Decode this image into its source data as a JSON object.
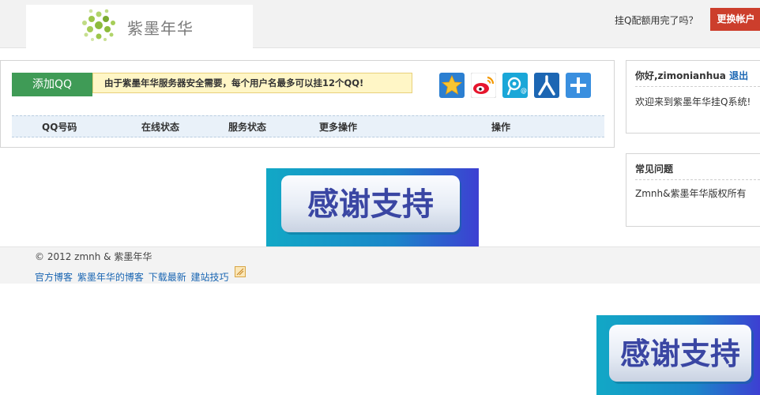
{
  "header": {
    "logo_text": "紫墨年华",
    "quota_link": "挂Q配额用完了吗？",
    "switch_account": "更换帐户"
  },
  "main": {
    "add_qq_button": "添加QQ",
    "notice": "由于紫墨年华服务器安全需要，每个用户名最多可以挂12个QQ!",
    "share_icons": [
      "qzone-icon",
      "weibo-icon",
      "tencent-weibo-icon",
      "renren-icon",
      "more-share-icon"
    ],
    "table_headers": [
      "QQ号码",
      "在线状态",
      "服务状态",
      "更多操作",
      "操作"
    ],
    "colors": {
      "add_button": "#3f9b56",
      "notice_bg": "#fff6c6",
      "table_head_bg": "#e9f1f9",
      "switch_button": "#cc3e2c"
    }
  },
  "sidebar": {
    "greeting": "你好,zimonianhua",
    "logout": "退出",
    "welcome": "欢迎来到紫墨年华挂Q系统!",
    "faq_title": "常见问题",
    "faq_text": "Zmnh&紫墨年华版权所有"
  },
  "banner": {
    "text": "感谢支持"
  },
  "footer": {
    "copyright": "© 2012 zmnh & 紫墨年华",
    "links": [
      "官方博客",
      "紫墨年华的博客",
      "下载最新",
      "建站技巧"
    ]
  }
}
